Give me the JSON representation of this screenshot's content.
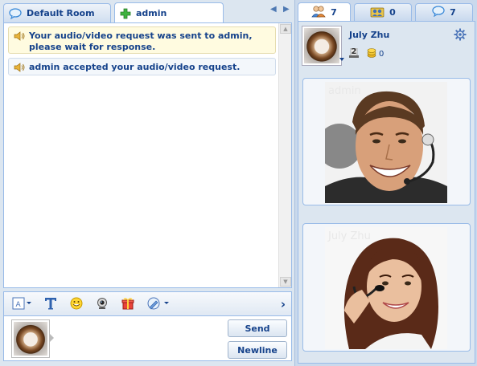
{
  "tabs": [
    {
      "label": "Default Room",
      "icon": "speech-bubble-icon",
      "active": false
    },
    {
      "label": "admin",
      "icon": "green-plus-icon",
      "active": true
    }
  ],
  "messages": [
    {
      "text": "Your audio/video request was sent to admin, please wait for response.",
      "icon": "speaker-icon"
    },
    {
      "text": "admin accepted your audio/video request.",
      "icon": "speaker-icon"
    }
  ],
  "toolbar": {
    "items": [
      "font-size-icon",
      "text-format-icon",
      "emoticon-icon",
      "webcam-icon",
      "gift-icon",
      "paint-brush-icon"
    ],
    "more": "›"
  },
  "buttons": {
    "send": "Send",
    "newline": "Newline"
  },
  "right_tabs": [
    {
      "count": "7",
      "icon": "users-icon",
      "active": true
    },
    {
      "count": "0",
      "icon": "group-icon",
      "active": false
    },
    {
      "count": "7",
      "icon": "chat-bubble-icon",
      "active": false
    }
  ],
  "profile": {
    "name": "July Zhu",
    "level": "2",
    "coins": "0"
  },
  "videos": [
    {
      "label": "admin",
      "kind": "man"
    },
    {
      "label": "July Zhu",
      "kind": "woman"
    }
  ],
  "colors": {
    "accent": "#15428b",
    "border": "#99bbe8",
    "panel": "#dce6f0"
  }
}
